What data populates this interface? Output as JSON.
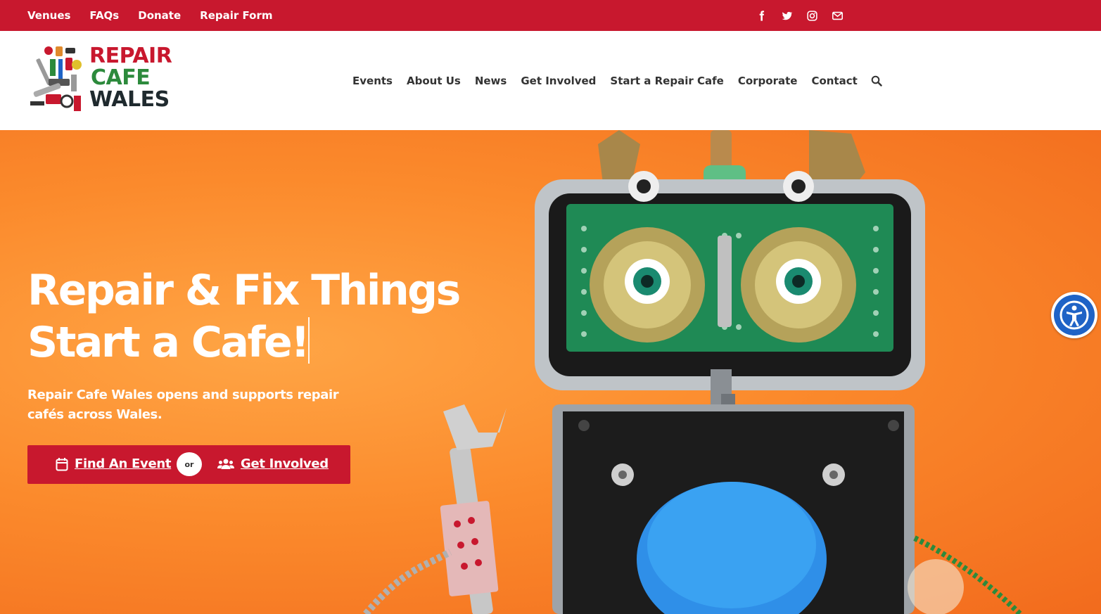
{
  "topbar": {
    "links": [
      "Venues",
      "FAQs",
      "Donate",
      "Repair Form"
    ],
    "social_icons": [
      "facebook-icon",
      "twitter-icon",
      "instagram-icon",
      "email-icon"
    ],
    "background": "#c8182e"
  },
  "logo": {
    "line1": "REPAIR",
    "line2": "CAFE",
    "line3": "WALES",
    "colors": {
      "repair": "#c8182e",
      "cafe": "#2c8a3c",
      "wales": "#1f2a2e"
    }
  },
  "nav": {
    "items": [
      "Events",
      "About Us",
      "News",
      "Get Involved",
      "Start a Repair Cafe",
      "Corporate",
      "Contact"
    ],
    "search_icon": "search-icon"
  },
  "hero": {
    "headline_line1": "Repair & Fix Things",
    "headline_line2": "Start a Cafe!",
    "subtext": "Repair Cafe Wales opens and supports repair cafés across Wales.",
    "cta": {
      "find_event": "Find An Event",
      "or": "or",
      "get_involved": "Get Involved",
      "find_icon": "calendar-icon",
      "involved_icon": "users-icon",
      "color": "#c8182e"
    },
    "accent_orange": "#fb8a2c"
  },
  "accessibility": {
    "icon": "accessibility-icon",
    "color": "#1f63c6"
  }
}
